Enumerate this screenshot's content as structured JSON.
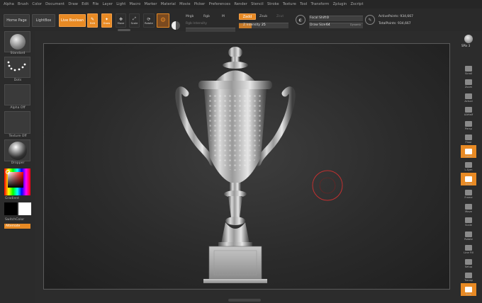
{
  "menu": [
    "Alpha",
    "Brush",
    "Color",
    "Document",
    "Draw",
    "Edit",
    "File",
    "Layer",
    "Light",
    "Macro",
    "Marker",
    "Material",
    "Movie",
    "Picker",
    "Preferences",
    "Render",
    "Stencil",
    "Stroke",
    "Texture",
    "Tool",
    "Transform",
    "Zplugin",
    "Zscript"
  ],
  "toolbar": {
    "home_page": "Home Page",
    "lightbox": "LightBox",
    "live_boolean": "Live Boolean",
    "edit": "Edit",
    "draw": "Draw",
    "move": "Move",
    "scale": "Scale",
    "rotate": "Rotate",
    "mrgb": "Mrgb",
    "rgb": "Rgb",
    "m": "M",
    "rgb_intensity": "Rgb Intensity",
    "zadd": "Zadd",
    "zsub": "Zsub",
    "zcut": "Zcut",
    "z_intensity_label": "Z Intensity",
    "z_intensity_value": "25",
    "focal_shift_label": "Focal Shift",
    "focal_shift_value": "0",
    "draw_size_label": "Draw Size",
    "draw_size_value": "64",
    "dynamic": "Dynamic",
    "active_points": "ActivePoints: 934,667",
    "total_points": "TotalPoints: 934,667"
  },
  "left": {
    "brush": "Standard",
    "stroke": "Dots",
    "alpha": "Alpha Off",
    "texture": "Texture Off",
    "material": "Dropper",
    "gradient": "Gradient",
    "switch_color": "SwitchColor",
    "alternate": "Alternate"
  },
  "right": {
    "spix": "SPix 3",
    "items": [
      "BPR",
      "Scroll",
      "Zoom",
      "Actual",
      "AAHalf",
      "Persp",
      "Floor",
      "Local",
      "L.Sym",
      "Gxyz",
      "Frame",
      "Move",
      "Scale",
      "Rotate",
      "Line Fill",
      "Setup",
      "Transp",
      "Solo"
    ]
  },
  "colors": {
    "accent": "#e88a24",
    "bg": "#2c2c2c",
    "brush_cursor": "#c23030"
  }
}
